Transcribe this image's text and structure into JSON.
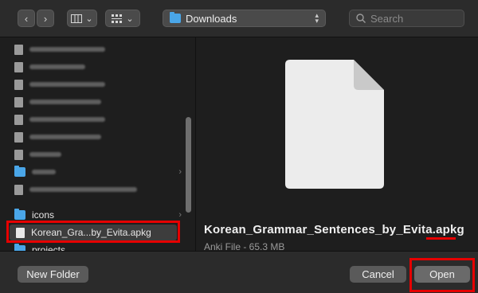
{
  "toolbar": {
    "back_icon": "chevron-left-icon",
    "forward_icon": "chevron-right-icon",
    "view_icon": "column-view-icon",
    "group_icon": "grid-icon",
    "location": "Downloads",
    "search_placeholder": "Search"
  },
  "sidebar": {
    "items": [
      {
        "type": "file",
        "label": "",
        "blurred": true
      },
      {
        "type": "file",
        "label": "",
        "blurred": true
      },
      {
        "type": "file",
        "label": "",
        "blurred": true
      },
      {
        "type": "file",
        "label": "",
        "blurred": true
      },
      {
        "type": "file",
        "label": "",
        "blurred": true
      },
      {
        "type": "file",
        "label": "",
        "blurred": true
      },
      {
        "type": "file",
        "label": "",
        "blurred": true
      },
      {
        "type": "folder",
        "label": "",
        "blurred": true
      },
      {
        "type": "folder",
        "label": "",
        "blurred": true
      },
      {
        "type": "file",
        "label": "",
        "blurred": true
      },
      {
        "type": "folder",
        "label": "icons",
        "blurred": false
      },
      {
        "type": "file",
        "label": "Korean_Gra...by_Evita.apkg",
        "blurred": false,
        "selected": true
      },
      {
        "type": "folder",
        "label": "projects",
        "blurred": false
      }
    ]
  },
  "preview": {
    "file_name": "Korean_Grammar_Sentences_by_Evita.apkg",
    "file_meta": "Anki File - 65.3 MB"
  },
  "bottom": {
    "new_folder": "New Folder",
    "cancel": "Cancel",
    "open": "Open"
  },
  "colors": {
    "accent": "#4aa6e8",
    "highlight": "#e60000"
  }
}
